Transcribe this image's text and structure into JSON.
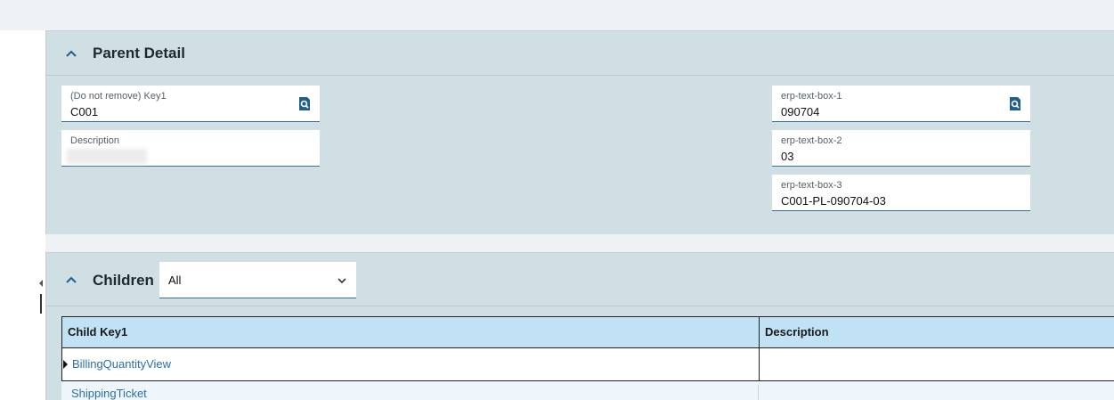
{
  "parent_detail": {
    "title": "Parent Detail",
    "fields_left": [
      {
        "label": "(Do not remove) Key1",
        "value": "C001",
        "has_lookup": true
      },
      {
        "label": "Description",
        "value": "",
        "blurred": true
      }
    ],
    "fields_right": [
      {
        "label": "erp-text-box-1",
        "value": "090704",
        "has_lookup": true
      },
      {
        "label": "erp-text-box-2",
        "value": "03"
      },
      {
        "label": "erp-text-box-3",
        "value": "C001-PL-090704-03"
      }
    ]
  },
  "children": {
    "title": "Children",
    "filter": {
      "selected": "All"
    },
    "grid": {
      "columns": [
        "Child Key1",
        "Description"
      ],
      "rows": [
        {
          "key": "BillingQuantityView",
          "description": "",
          "current": true
        },
        {
          "key": "ShippingTicket",
          "description": ""
        }
      ]
    }
  },
  "colors": {
    "panel_bg": "#d0dfe4",
    "header_row_bg": "#c0e2f4",
    "link": "#2a6fa8",
    "accent": "#1f5f8a"
  }
}
